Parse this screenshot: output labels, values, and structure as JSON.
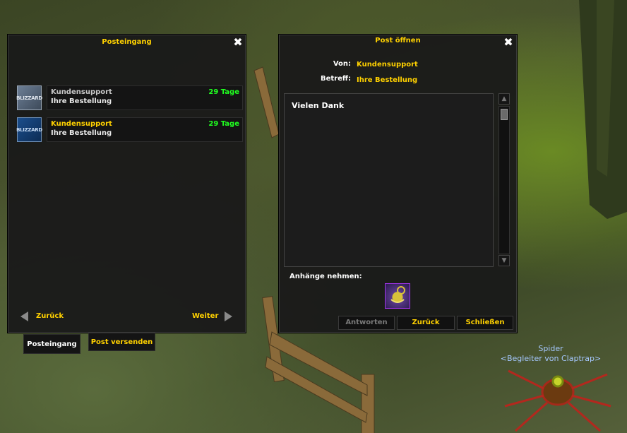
{
  "inbox": {
    "title": "Posteingang",
    "mails": [
      {
        "icon": "BLIZZARD",
        "sender": "Kundensupport",
        "subject": "Ihre Bestellung",
        "days": "29 Tage",
        "read": true
      },
      {
        "icon": "BLIZZARD",
        "sender": "Kundensupport",
        "subject": "Ihre Bestellung",
        "days": "29 Tage",
        "read": false
      }
    ],
    "prev_label": "Zurück",
    "next_label": "Weiter",
    "tabs": [
      "Posteingang",
      "Post versenden"
    ]
  },
  "open_mail": {
    "title": "Post öffnen",
    "from_label": "Von:",
    "from_value": "Kundensupport",
    "subject_label": "Betreff:",
    "subject_value": "Ihre Bestellung",
    "body": "Vielen Dank",
    "attachments_label": "Anhänge nehmen:",
    "attachment_icon": "pet-cage-item-icon",
    "buttons": {
      "reply": "Antworten",
      "back": "Zurück",
      "close": "Schließen"
    }
  },
  "npc": {
    "name": "Spider",
    "title": "<Begleiter von Claptrap>"
  },
  "colors": {
    "gold": "#ffd100",
    "green": "#20ff20",
    "npc_blue": "#a6c8ff",
    "disabled": "#7a7a7a"
  }
}
